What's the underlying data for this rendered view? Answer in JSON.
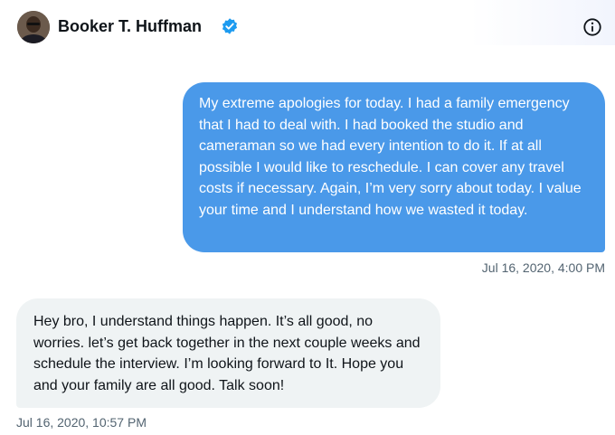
{
  "header": {
    "name": "Booker T. Huffman",
    "verified_icon": "verified-badge-icon",
    "info_icon": "info-icon"
  },
  "colors": {
    "outgoing_bubble": "#4a99e9",
    "incoming_bubble": "#eff3f4",
    "verified": "#1d9bf0",
    "timestamp": "#536471"
  },
  "messages": [
    {
      "direction": "outgoing",
      "text": "My extreme apologies for today. I had a family emergency that I had to deal with.  I had booked the studio and cameraman so we had every intention to do it. If at all possible I would like to reschedule.  I can cover any travel costs if necessary. Again, I’m very sorry about today. I value your time and I understand how we wasted it today.",
      "timestamp": "Jul 16, 2020, 4:00 PM"
    },
    {
      "direction": "incoming",
      "text": "Hey bro, I understand things happen. It’s all good, no worries. let’s get back together in the next couple weeks and schedule the interview. I’m looking forward to It. Hope you and your family are all good. Talk soon!",
      "timestamp": "Jul 16, 2020, 10:57 PM"
    }
  ]
}
